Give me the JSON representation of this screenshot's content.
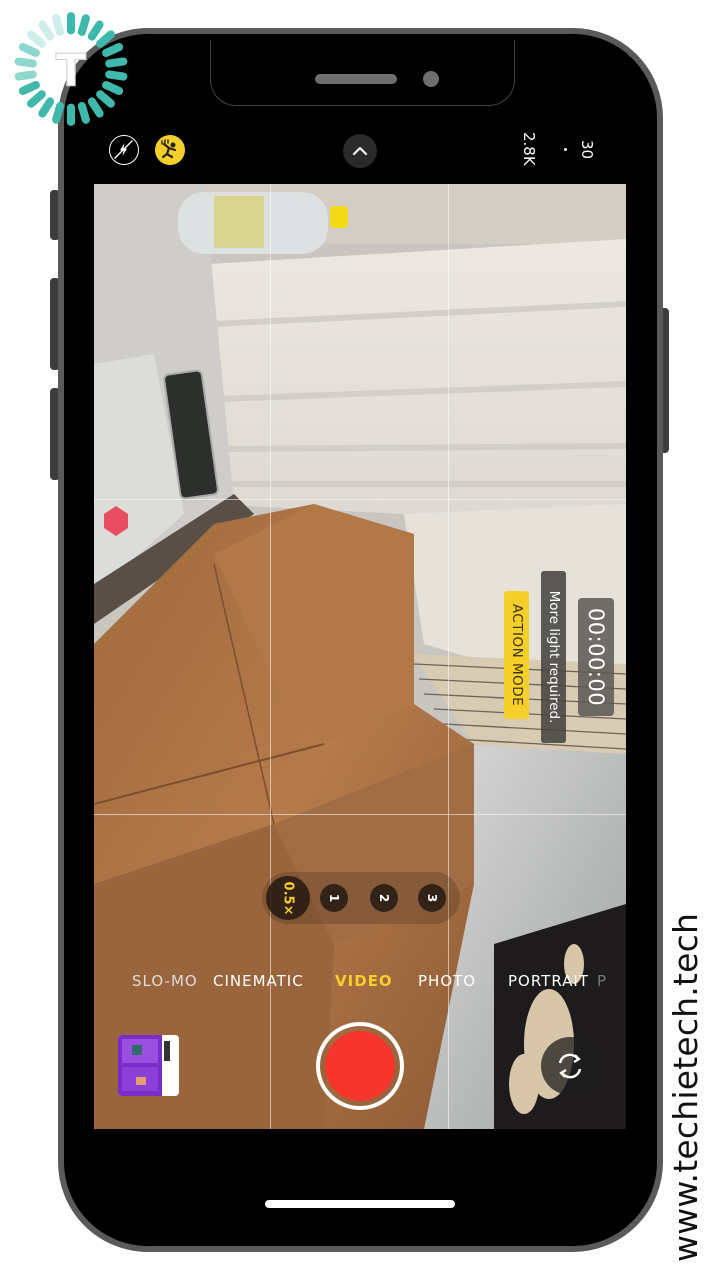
{
  "watermark": "www.techietech.tech",
  "logo": {
    "name": "techietech-logo",
    "letter": "T",
    "color": "#3fb9ac"
  },
  "topbar": {
    "flash_icon": "flash-off-icon",
    "action_mode_icon": "action-mode-icon",
    "chevron_icon": "chevron-up-icon",
    "resolution": "2.8K",
    "separator": "·",
    "frame_rate": "30"
  },
  "viewfinder": {
    "timer": "00:00:00",
    "warning": "More light required.",
    "action_mode_badge": "ACTION MODE"
  },
  "zoom": {
    "options": [
      {
        "label": "0.5×",
        "active": true
      },
      {
        "label": "1",
        "active": false
      },
      {
        "label": "2",
        "active": false
      },
      {
        "label": "3",
        "active": false
      }
    ]
  },
  "modes": {
    "items": [
      {
        "label": "SLO-MO",
        "active": false
      },
      {
        "label": "CINEMATIC",
        "active": false
      },
      {
        "label": "VIDEO",
        "active": true
      },
      {
        "label": "PHOTO",
        "active": false
      },
      {
        "label": "PORTRAIT",
        "active": false
      },
      {
        "label": "P",
        "active": false
      }
    ]
  },
  "controls": {
    "thumbnail_icon": "last-photo-thumbnail",
    "shutter_icon": "record-button",
    "flip_icon": "camera-flip-icon"
  },
  "colors": {
    "accent_yellow": "#f5cf2a",
    "record_red": "#f6362c",
    "frame_gray": "#5a5a5a"
  }
}
